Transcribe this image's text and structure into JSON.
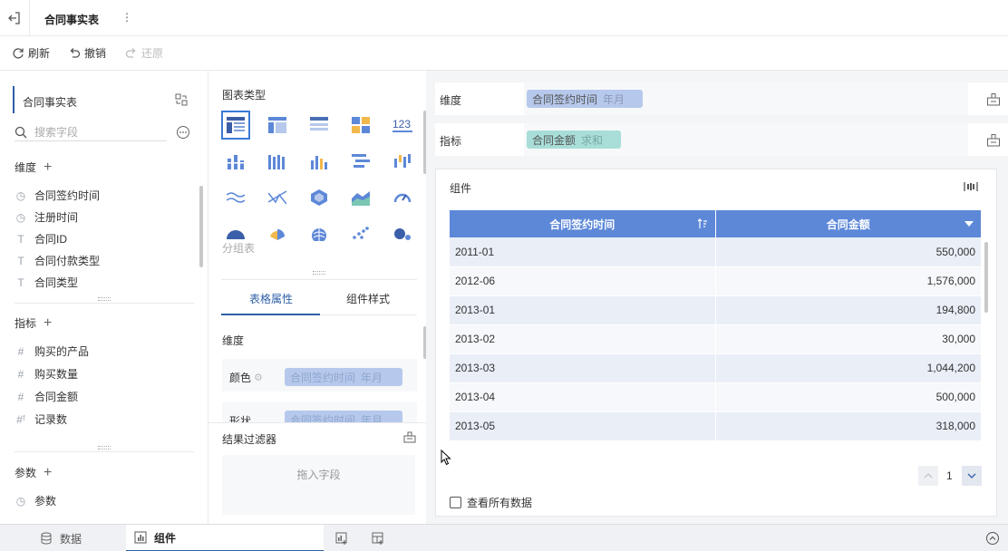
{
  "header": {
    "title": "合同事实表",
    "more_icon": "more-vertical-icon"
  },
  "toolbar": {
    "refresh": "刷新",
    "undo": "撤销",
    "redo": "还原"
  },
  "left": {
    "table_name": "合同事实表",
    "search_placeholder": "搜索字段",
    "dimension_title": "维度",
    "dimensions": [
      {
        "name": "合同签约时间",
        "icon": "clock-icon"
      },
      {
        "name": "注册时间",
        "icon": "clock-icon"
      },
      {
        "name": "合同ID",
        "icon": "text-type-icon"
      },
      {
        "name": "合同付款类型",
        "icon": "text-type-icon"
      },
      {
        "name": "合同类型",
        "icon": "text-type-icon"
      }
    ],
    "measure_title": "指标",
    "measures": [
      {
        "name": "购买的产品",
        "icon": "hash-icon"
      },
      {
        "name": "购买数量",
        "icon": "hash-icon"
      },
      {
        "name": "合同金额",
        "icon": "hash-icon"
      },
      {
        "name": "记录数",
        "icon": "hash-calc-icon"
      }
    ],
    "param_title": "参数",
    "params": [
      {
        "name": "参数",
        "icon": "clock-icon"
      }
    ]
  },
  "middle": {
    "chart_type_title": "图表类型",
    "group_table_label": "分组表",
    "tabs": [
      "表格属性",
      "组件样式"
    ],
    "dimension_label": "维度",
    "color_label": "颜色",
    "color_pill": {
      "field": "合同签约时间",
      "agg": "年月"
    },
    "shape_label": "形状",
    "shape_pill": {
      "field": "合同签约时间",
      "agg": "年月"
    },
    "filter_title": "结果过滤器",
    "filter_drop": "拖入字段"
  },
  "right": {
    "dimension_shelf": {
      "label": "维度",
      "pill_field": "合同签约时间",
      "pill_agg": "年月"
    },
    "measure_shelf": {
      "label": "指标",
      "pill_field": "合同金额",
      "pill_agg": "求和"
    },
    "component_title": "组件",
    "table": {
      "columns": [
        "合同签约时间",
        "合同金额"
      ],
      "rows": [
        [
          "2011-01",
          "550,000"
        ],
        [
          "2012-06",
          "1,576,000"
        ],
        [
          "2013-01",
          "194,800"
        ],
        [
          "2013-02",
          "30,000"
        ],
        [
          "2013-03",
          "1,044,200"
        ],
        [
          "2013-04",
          "500,000"
        ],
        [
          "2013-05",
          "318,000"
        ]
      ]
    },
    "page_number": "1",
    "view_all": "查看所有数据"
  },
  "bottom": {
    "tabs": [
      "数据",
      "组件"
    ]
  },
  "colors": {
    "accent": "#2f5fa7",
    "table_header": "#5d88d8",
    "dim_pill": "#b6c9ec",
    "measure_pill": "#a8ddd8"
  }
}
